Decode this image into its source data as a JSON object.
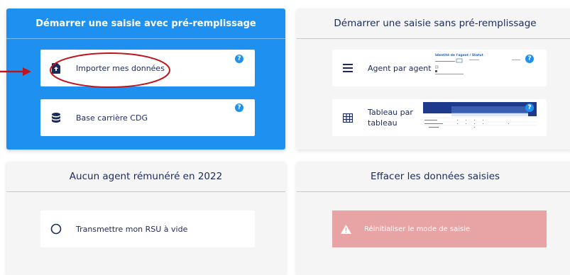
{
  "prefill_panel": {
    "title": "Démarrer une saisie avec pré-remplissage",
    "import_card": {
      "label": "Importer mes données",
      "icon": "file-upload-icon",
      "help": "?"
    },
    "cdg_card": {
      "label": "Base carrière CDG",
      "icon": "database-icon",
      "help": "?"
    }
  },
  "no_prefill_panel": {
    "title": "Démarrer une saisie sans pré-remplissage",
    "agent_card": {
      "label": "Agent par agent",
      "icon": "list-icon",
      "help": "?",
      "thumb_title": "Identité de l'agent / Statut"
    },
    "table_card": {
      "label_line1": "Tableau par",
      "label_line2": "tableau",
      "icon": "table-grid-icon",
      "help": "?"
    }
  },
  "no_agent_panel": {
    "title": "Aucun agent rémunéré en 2022",
    "empty_card": {
      "label": "Transmettre mon RSU à vide",
      "icon": "radio-circle-icon"
    }
  },
  "clear_panel": {
    "title": "Effacer les données saisies",
    "reset_card": {
      "label": "Réinitialiser le mode de saisie",
      "icon": "warning-icon"
    }
  },
  "colors": {
    "primary_blue": "#1e90f0",
    "annotation_red": "#c0141c",
    "reset_red": "#e8a4a4",
    "text_navy": "#1b2a5a"
  }
}
